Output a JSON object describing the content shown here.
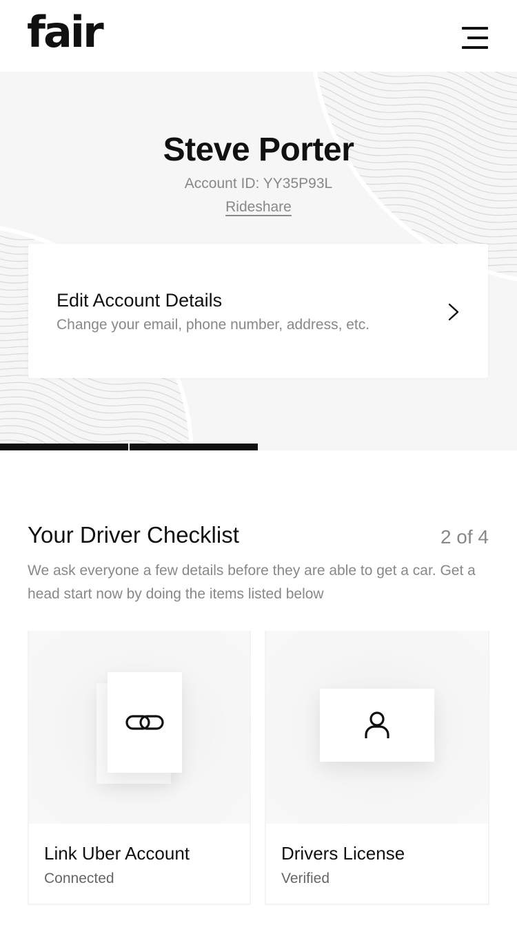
{
  "header": {
    "logo": "fair",
    "menu_icon": "hamburger-menu-icon"
  },
  "profile": {
    "name": "Steve Porter",
    "account_id": "Account ID: YY35P93L",
    "program": "Rideshare"
  },
  "edit_account": {
    "title": "Edit Account Details",
    "subtitle": "Change your email, phone number, address, etc.",
    "icon": "chevron-right-icon"
  },
  "progress": {
    "completed": 2,
    "total": 4
  },
  "checklist": {
    "title": "Your Driver Checklist",
    "count": "2 of 4",
    "description": "We ask everyone a few details before they are able to get a car. Get a head start now by doing the items listed below",
    "items": [
      {
        "label": "Link Uber Account",
        "status": "Connected",
        "icon": "link-icon"
      },
      {
        "label": "Drivers License",
        "status": "Verified",
        "icon": "user-icon"
      }
    ]
  },
  "colors": {
    "text": "#111111",
    "muted": "#888888",
    "hero_bg": "#f6f6f6",
    "progress": "#111111"
  }
}
